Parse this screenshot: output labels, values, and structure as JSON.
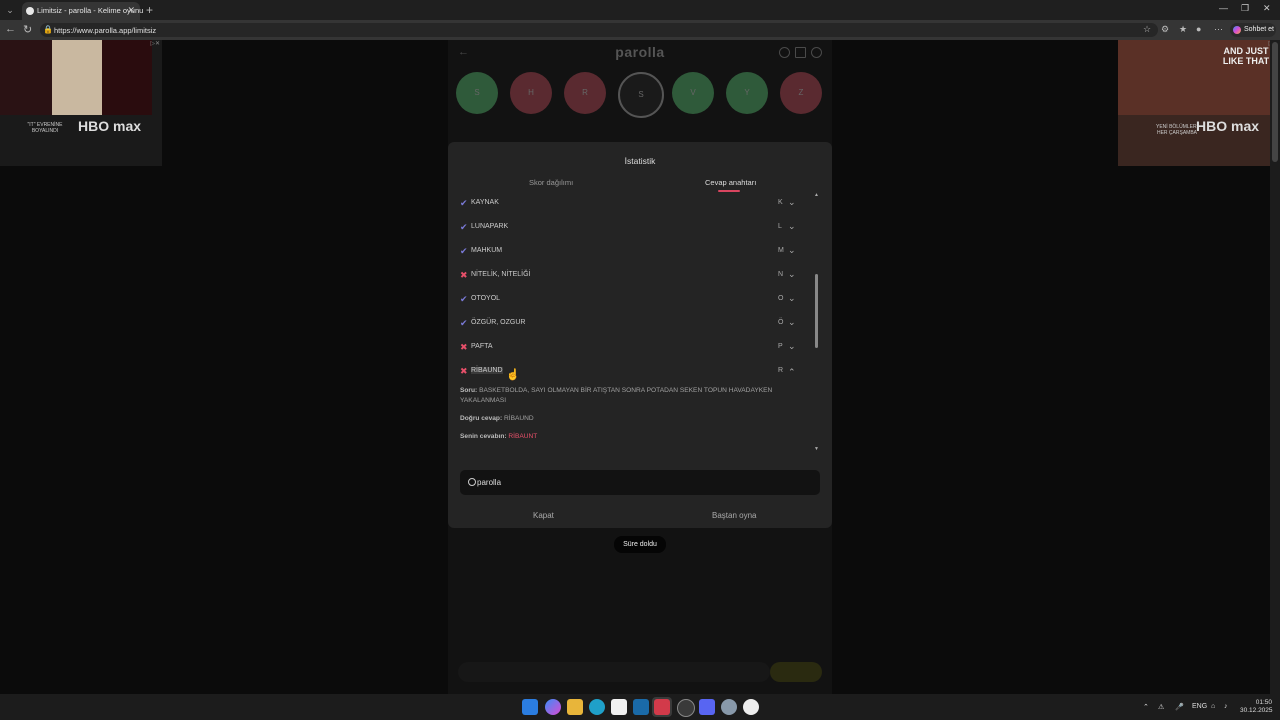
{
  "browser": {
    "tab_title": "Limitsiz - parolla - Kelime oyunu",
    "url": "https://www.parolla.app/limitsiz",
    "chat_label": "Sohbet et"
  },
  "ads": {
    "left": {
      "tagline": "\"IT\" EVRENİNE BOYALINDI",
      "brand": "HBO max"
    },
    "right": {
      "tagline": "YENİ BÖLÜMLERİ HER ÇARŞAMBA",
      "title": "AND JUST LIKE THAT",
      "brand": "HBO max"
    }
  },
  "game": {
    "brand": "parolla",
    "letters": [
      {
        "letter": "S",
        "color": "#2f5a3a"
      },
      {
        "letter": "H",
        "color": "#5a2a30"
      },
      {
        "letter": "R",
        "color": "#5a2a30"
      },
      {
        "letter": "S",
        "color": "#1a1a1a"
      },
      {
        "letter": "V",
        "color": "#2f5a3a"
      },
      {
        "letter": "Y",
        "color": "#2f5a3a"
      },
      {
        "letter": "Z",
        "color": "#5a2a30"
      }
    ]
  },
  "modal": {
    "title": "İstatistik",
    "tabs": {
      "score": "Skor dağılımı",
      "answer_key": "Cevap anahtarı",
      "active": "answer_key"
    },
    "rows": [
      {
        "word": "KAYNAK",
        "letter": "K",
        "correct": true,
        "expanded": false
      },
      {
        "word": "LUNAPARK",
        "letter": "L",
        "correct": true,
        "expanded": false
      },
      {
        "word": "MAHKUM",
        "letter": "M",
        "correct": true,
        "expanded": false
      },
      {
        "word": "NİTELİK, NİTELİĞİ",
        "letter": "N",
        "correct": false,
        "expanded": false
      },
      {
        "word": "OTOYOL",
        "letter": "O",
        "correct": true,
        "expanded": false
      },
      {
        "word": "ÖZGÜR, OZGUR",
        "letter": "Ö",
        "correct": true,
        "expanded": false
      },
      {
        "word": "PAFTA",
        "letter": "P",
        "correct": false,
        "expanded": false
      },
      {
        "word": "RİBAUND",
        "letter": "R",
        "correct": false,
        "expanded": true
      }
    ],
    "detail": {
      "question_label": "Soru:",
      "question": "BASKETBOLDA, SAYI OLMAYAN BİR ATIŞTAN SONRA POTADAN SEKEN TOPUN HAVADAYKEN YAKALANMASI",
      "correct_label": "Doğru cevap:",
      "correct_answer": "RİBAUND",
      "your_label": "Senin cevabın:",
      "your_answer": "RİBAUNT"
    },
    "share_label": "parolla",
    "close_label": "Kapat",
    "restart_label": "Baştan oyna"
  },
  "toast": "Süre doldu",
  "taskbar": {
    "lang": "ENG",
    "time": "01:50",
    "date": "30.12.2025"
  }
}
